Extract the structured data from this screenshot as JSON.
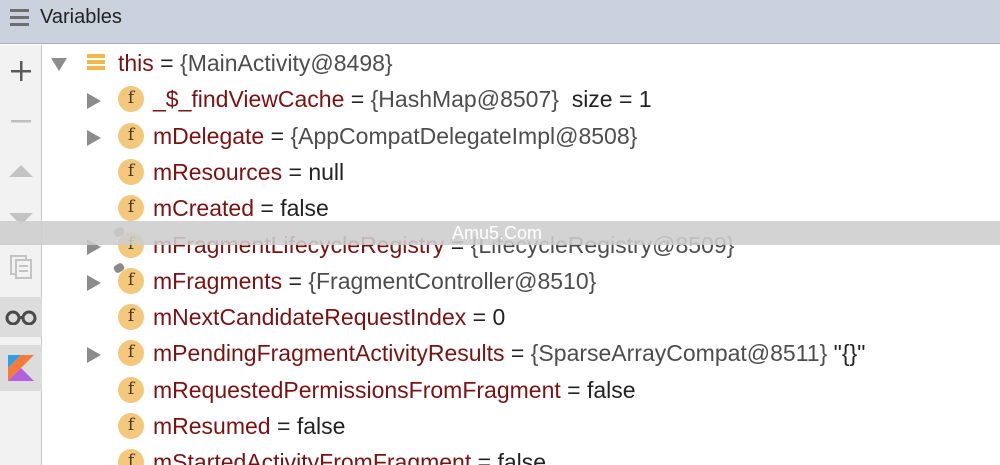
{
  "header": {
    "title": "Variables",
    "menu_icon": "hamburger-menu-icon"
  },
  "toolbar": {
    "buttons": [
      {
        "icon": "plus-icon"
      },
      {
        "icon": "minus-icon"
      },
      {
        "icon": "arrow-up-icon"
      },
      {
        "icon": "arrow-down-icon"
      },
      {
        "icon": "copy-icon"
      },
      {
        "icon": "glasses-icon"
      },
      {
        "icon": "kotlin-icon"
      }
    ]
  },
  "tree": {
    "root": {
      "name": "this",
      "eq": " = ",
      "value": "{MainActivity@8498}"
    },
    "fields": [
      {
        "name": "_$_findViewCache",
        "eq": " = ",
        "value": "{HashMap@8507}",
        "extra": "  size = 1",
        "expandable": true
      },
      {
        "name": "mDelegate",
        "eq": " = ",
        "value": "{AppCompatDelegateImpl@8508}",
        "expandable": true
      },
      {
        "name": "mResources",
        "eq": " = ",
        "value": "null",
        "expandable": false
      },
      {
        "name": "mCreated",
        "eq": " = ",
        "value": "false",
        "expandable": false
      },
      {
        "name": "mFragmentLifecycleRegistry",
        "eq": " = ",
        "value": "{LifecycleRegistry@8509}",
        "expandable": true
      },
      {
        "name": "mFragments",
        "eq": " = ",
        "value": "{FragmentController@8510}",
        "expandable": true
      },
      {
        "name": "mNextCandidateRequestIndex",
        "eq": " = ",
        "value": "0",
        "expandable": false
      },
      {
        "name": "mPendingFragmentActivityResults",
        "eq": " = ",
        "value": "{SparseArrayCompat@8511}",
        "extra": " \"{}\"",
        "expandable": true
      },
      {
        "name": "mRequestedPermissionsFromFragment",
        "eq": " = ",
        "value": "false",
        "expandable": false
      },
      {
        "name": "mResumed",
        "eq": " = ",
        "value": "false",
        "expandable": false
      },
      {
        "name": "mStartedActivityFromFragment",
        "eq": " = ",
        "value": "false",
        "expandable": false
      }
    ],
    "field_icon_letter": "f"
  },
  "watermark": {
    "text": "Amu5.Com"
  },
  "colors": {
    "header_bg": "#ccd2dd",
    "field_icon": "#f3c87c",
    "name": "#7a1212"
  }
}
